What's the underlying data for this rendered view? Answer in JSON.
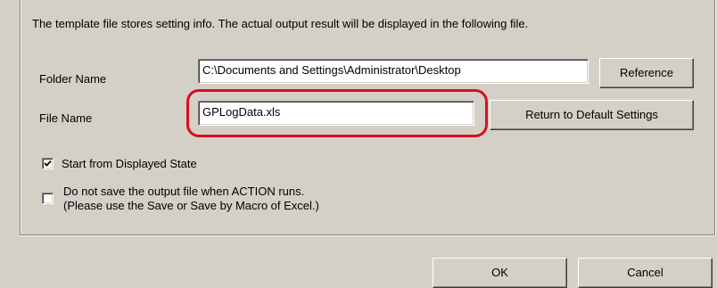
{
  "info_text": "The template file stores setting info. The actual output result will be displayed in the following file.",
  "folder": {
    "label": "Folder Name",
    "value": "C:\\Documents and Settings\\Administrator\\Desktop",
    "button": "Reference"
  },
  "file": {
    "label": "File Name",
    "value": "GPLogData.xls",
    "button": "Return to Default Settings"
  },
  "options": {
    "start_displayed": {
      "label": "Start from Displayed State",
      "checked": true
    },
    "no_save": {
      "line1": "Do not save the output file when ACTION runs.",
      "line2": "(Please use the Save or Save by Macro of Excel.)",
      "checked": false
    }
  },
  "footer": {
    "ok": "OK",
    "cancel": "Cancel"
  },
  "colors": {
    "face": "#d4d0c8",
    "highlight": "#d8101c"
  }
}
